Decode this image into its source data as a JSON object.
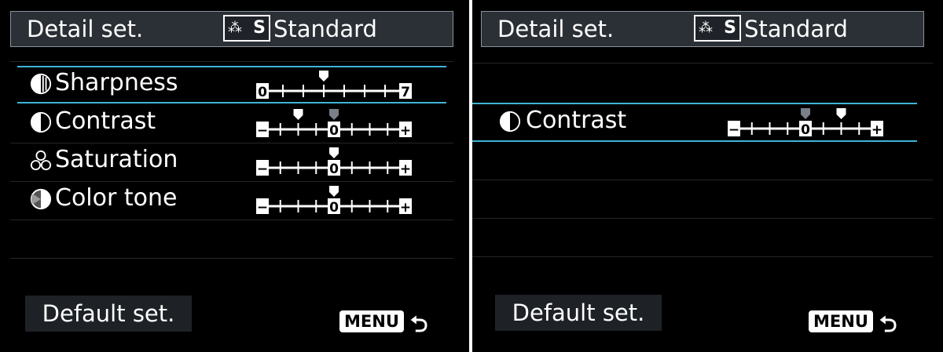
{
  "left": {
    "header": {
      "title": "Detail set.",
      "style_code": "S",
      "style_label": "Standard"
    },
    "rows": [
      {
        "label": "Sharpness",
        "icon": "sharpness-icon",
        "scale_left": "0",
        "scale_right": "7",
        "selected": true
      },
      {
        "label": "Contrast",
        "icon": "contrast-icon",
        "scale_left": "−",
        "scale_center": "0",
        "scale_right": "+"
      },
      {
        "label": "Saturation",
        "icon": "saturation-icon",
        "scale_left": "−",
        "scale_center": "0",
        "scale_right": "+"
      },
      {
        "label": "Color tone",
        "icon": "color-tone-icon",
        "scale_left": "−",
        "scale_center": "0",
        "scale_right": "+"
      }
    ],
    "values": {
      "sharpness": {
        "current": 3,
        "min": 0,
        "max": 7
      },
      "contrast": {
        "current": -2,
        "default": 0,
        "min": -4,
        "max": 4
      },
      "saturation": {
        "current": 0,
        "min": -4,
        "max": 4
      },
      "color_tone": {
        "current": 0,
        "min": -4,
        "max": 4
      }
    },
    "default_button": "Default set.",
    "menu_label": "MENU",
    "back_symbol": "⮌"
  },
  "right": {
    "header": {
      "title": "Detail set.",
      "style_code": "S",
      "style_label": "Standard"
    },
    "selected_row": {
      "label": "Contrast",
      "icon": "contrast-icon",
      "scale_left": "−",
      "scale_center": "0",
      "scale_right": "+"
    },
    "values": {
      "contrast": {
        "current": 2,
        "default": 0,
        "min": -4,
        "max": 4
      }
    },
    "default_button": "Default set.",
    "menu_label": "MENU",
    "back_symbol": "⮌"
  },
  "colors": {
    "selection": "#3fb5d6",
    "header_bg": "#2b3036",
    "screen_bg": "#000000",
    "default_marker": "#7a8088"
  }
}
